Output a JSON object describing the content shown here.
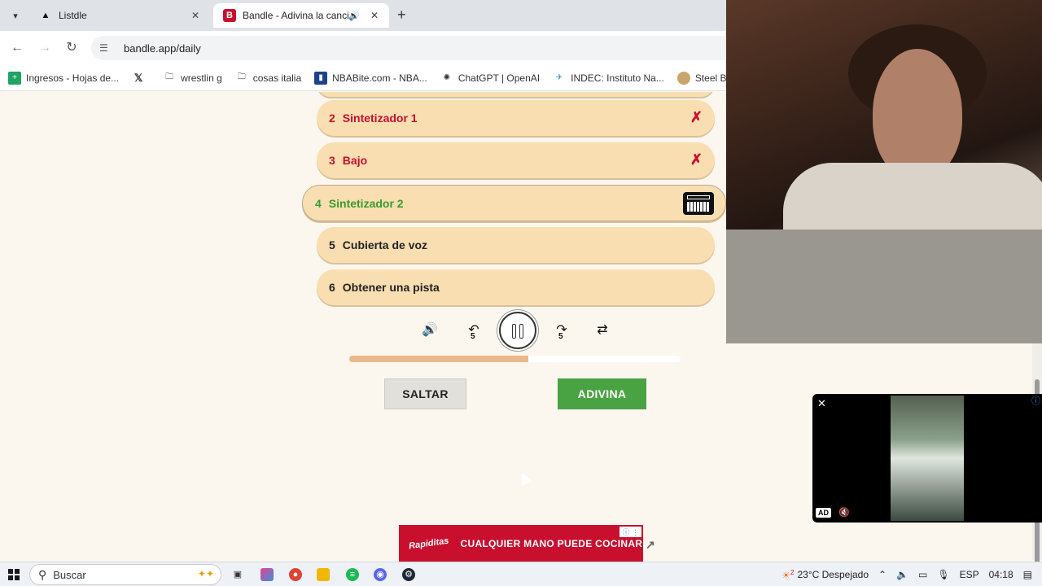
{
  "browser": {
    "tabs": [
      {
        "title": "Listdle",
        "favicon": "listdle-icon",
        "active": false
      },
      {
        "title": "Bandle - Adivina la canción",
        "favicon": "bandle-icon",
        "active": true
      }
    ],
    "url": "bandle.app/daily",
    "bookmarks": [
      {
        "label": "Ingresos - Hojas de...",
        "icon": "sheets-icon",
        "color": "#1fa463"
      },
      {
        "label": "",
        "icon": "x-icon",
        "color": "#000000"
      },
      {
        "label": "wrestlin g",
        "icon": "folder-icon",
        "color": "#555555"
      },
      {
        "label": "cosas italia",
        "icon": "folder-icon",
        "color": "#555555"
      },
      {
        "label": "NBABite.com - NBA...",
        "icon": "nba-icon",
        "color": "#c8102e"
      },
      {
        "label": "ChatGPT | OpenAI",
        "icon": "openai-icon",
        "color": "#444444"
      },
      {
        "label": "INDEC: Instituto Na...",
        "icon": "indec-icon",
        "color": "#3a8fd9"
      },
      {
        "label": "Steel Ball Run Mar",
        "icon": "sbr-icon",
        "color": "#8a6a3a"
      }
    ]
  },
  "game": {
    "rows": [
      {
        "num": "2",
        "label": "Sintetizador 1",
        "status": "wrong"
      },
      {
        "num": "3",
        "label": "Bajo",
        "status": "wrong"
      },
      {
        "num": "4",
        "label": "Sintetizador 2",
        "status": "current"
      },
      {
        "num": "5",
        "label": "Cubierta de voz",
        "status": "pending"
      },
      {
        "num": "6",
        "label": "Obtener una pista",
        "status": "pending"
      }
    ],
    "wrong_mark": "✗",
    "rewind_seconds": "5",
    "forward_seconds": "5",
    "progress": 0.54,
    "skip_label": "SALTAR",
    "guess_label": "ADIVINA",
    "colors": {
      "wrong": "#c8102e",
      "current": "#3b9a2f",
      "row_bg": "#f8deb1",
      "guess_bg": "#4aa342"
    }
  },
  "ad": {
    "brand": "Rapiditas",
    "text": "CUALQUIER MANO PUEDE COCINAR",
    "ad_label": "AD"
  },
  "taskbar": {
    "search_placeholder": "Buscar",
    "weather": "23°C  Despejado",
    "weather_badge": "2",
    "language": "ESP",
    "time": "04:18"
  }
}
